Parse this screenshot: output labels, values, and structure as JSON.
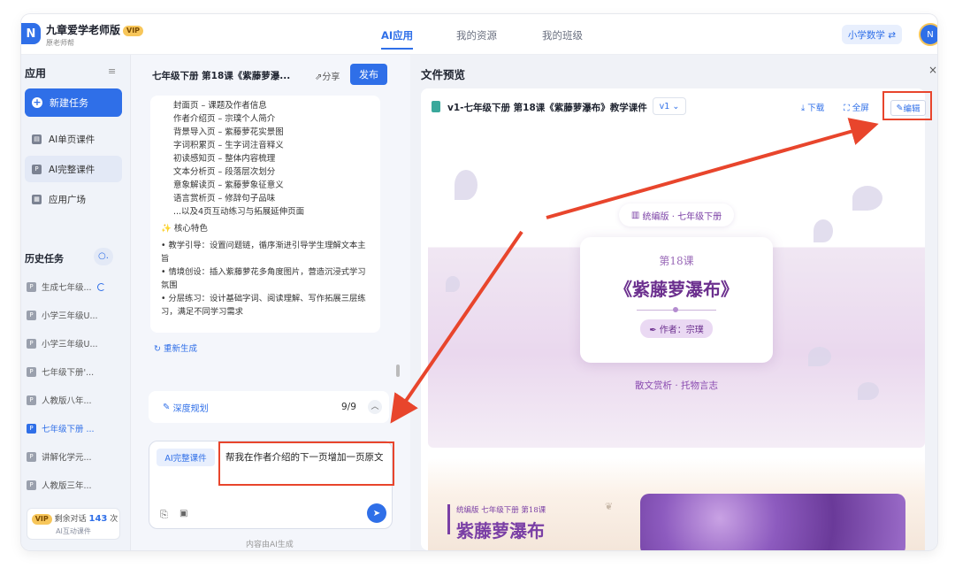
{
  "app": {
    "name": "九章爱学老师版",
    "vip_badge": "VIP",
    "subtitle": "原老师帮",
    "logo_icon": "jiuzhang-logo-icon"
  },
  "nav": {
    "tabs": [
      "AI应用",
      "我的资源",
      "我的班级"
    ],
    "active": "AI应用",
    "subject_switch": "小学数学 ⇄"
  },
  "sidebar": {
    "title": "应用",
    "new_task": "新建任务",
    "items": [
      {
        "label": "AI单页课件",
        "icon": "page-icon"
      },
      {
        "label": "AI完整课件",
        "icon": "ppt-icon",
        "selected": true
      },
      {
        "label": "应用广场",
        "icon": "grid-icon"
      }
    ],
    "history_title": "历史任务",
    "history": [
      {
        "label": "生成七年级...",
        "loading": true
      },
      {
        "label": "小学三年级U..."
      },
      {
        "label": "小学三年级U..."
      },
      {
        "label": "七年级下册'..."
      },
      {
        "label": "人教版八年..."
      },
      {
        "label": "七年级下册 ...",
        "selected": true
      },
      {
        "label": "讲解化学元..."
      },
      {
        "label": "人教版三年..."
      }
    ],
    "quota_prefix": "剩余对话",
    "quota_value": "143",
    "quota_unit": "次",
    "quota_caption": "AI互动课件"
  },
  "chat": {
    "title": "七年级下册 第18课《紫藤萝瀑...",
    "share": "分享",
    "publish": "发布",
    "outline": [
      "封面页 – 课题及作者信息",
      "作者介绍页 – 宗璞个人简介",
      "背景导入页 – 紫藤萝花实景图",
      "字词积累页 – 生字词注音释义",
      "初读感知页 – 整体内容梳理",
      "文本分析页 – 段落层次划分",
      "意象解读页 – 紫藤萝象征意义",
      "语言赏析页 – 修辞句子品味",
      "...以及4页互动练习与拓展延伸页面"
    ],
    "features_title": "核心特色",
    "features": [
      "教学引导：设置问题链，循序渐进引导学生理解文本主旨",
      "情境创设：插入紫藤萝花多角度图片，营造沉浸式学习氛围",
      "分层练习：设计基础字词、阅读理解、写作拓展三层练习，满足不同学习需求"
    ],
    "regenerate": "重新生成",
    "plan_label": "深度规划",
    "plan_count": "9/9",
    "input_tag": "AI完整课件",
    "input_text": "帮我在作者介绍的下一页增加一页原文",
    "footer": "内容由AI生成"
  },
  "preview": {
    "title": "文件预览",
    "file_name": "v1-七年级下册 第18课《紫藤萝瀑布》教学课件",
    "version": "v1",
    "download": "下载",
    "fullscreen": "全屏",
    "edit": "编辑",
    "slide1": {
      "badge": "统编版 · 七年级下册",
      "lesson": "第18课",
      "title": "《紫藤萝瀑布》",
      "author": "作者：宗璞",
      "subtitle": "散文赏析 · 托物言志"
    },
    "slide2": {
      "header": "统编版 七年级下册 第18课",
      "title": "紫藤萝瀑布"
    }
  },
  "colors": {
    "accent": "#2f6fe8",
    "annotation": "#e8452c",
    "purple": "#6b2f8e"
  }
}
